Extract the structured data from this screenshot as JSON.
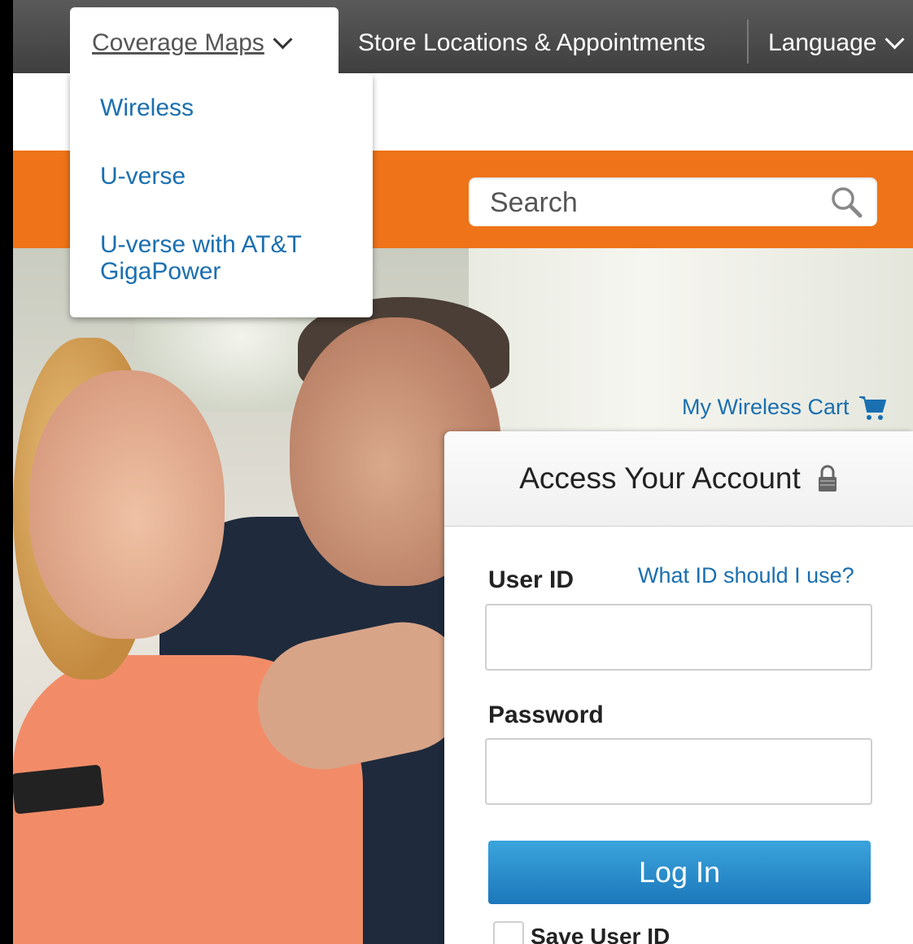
{
  "topnav": {
    "coverage_label": "Coverage Maps",
    "store_label": "Store Locations & Appointments",
    "language_label": "Language"
  },
  "coverage_menu": {
    "items": [
      "Wireless",
      "U-verse",
      "U-verse with AT&T GigaPower"
    ]
  },
  "search": {
    "placeholder": "Search"
  },
  "cart": {
    "label": "My Wireless Cart"
  },
  "login": {
    "title": "Access Your Account",
    "user_id_label": "User ID",
    "help_link": "What ID should I use?",
    "password_label": "Password",
    "button_label": "Log In",
    "save_label": "Save User ID"
  },
  "colors": {
    "accent_orange": "#ef7318",
    "link_blue": "#1a6fb0",
    "button_blue": "#1c78bb"
  }
}
